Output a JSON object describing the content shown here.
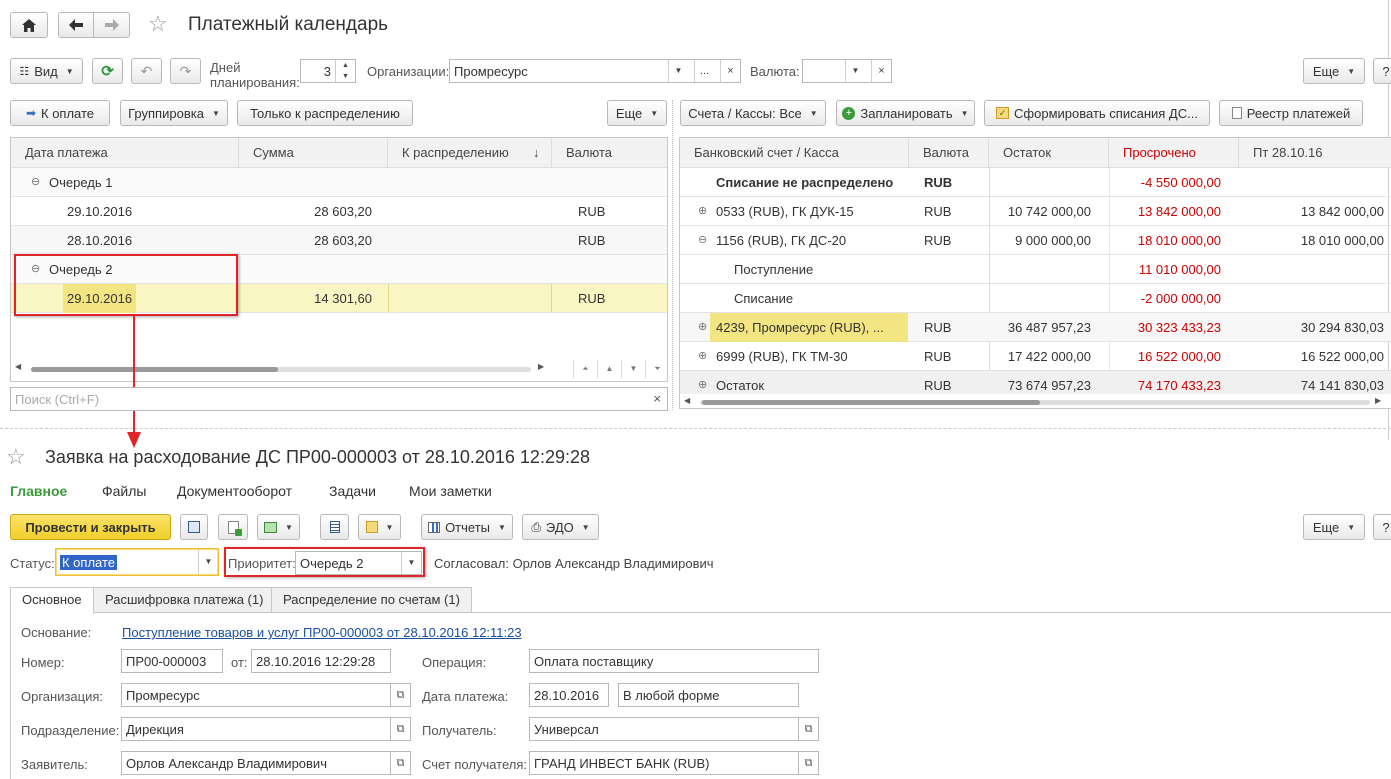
{
  "page": {
    "title": "Платежный календарь"
  },
  "toolbar1": {
    "view": "Вид",
    "days_label": "Дней планирования:",
    "days_value": "3",
    "org_label": "Организации:",
    "org_value": "Промресурс",
    "currency_label": "Валюта:",
    "currency_value": "",
    "more": "Еще",
    "help": "?"
  },
  "left_toolbar": {
    "to_pay": "К оплате",
    "grouping": "Группировка",
    "only_distr": "Только к распределению",
    "more": "Еще"
  },
  "left_table": {
    "columns": [
      "Дата платежа",
      "Сумма",
      "К распределению",
      "Валюта"
    ],
    "sort_glyph": "↓",
    "groups": [
      {
        "name": "Очередь 1",
        "rows": [
          {
            "date": "29.10.2016",
            "sum": "28 603,20",
            "distr": "",
            "cur": "RUB"
          },
          {
            "date": "28.10.2016",
            "sum": "28 603,20",
            "distr": "",
            "cur": "RUB"
          }
        ]
      },
      {
        "name": "Очередь 2",
        "rows": [
          {
            "date": "29.10.2016",
            "sum": "14 301,60",
            "distr": "",
            "cur": "RUB"
          }
        ]
      }
    ],
    "search_placeholder": "Поиск (Ctrl+F)"
  },
  "right_toolbar": {
    "accounts": "Счета / Кассы: Все",
    "plan": "Запланировать",
    "form_writeoff": "Сформировать списания ДС...",
    "registry": "Реестр платежей"
  },
  "right_table": {
    "columns": [
      "Банковский счет / Касса",
      "Валюта",
      "Остаток",
      "Просрочено",
      "Пт 28.10.16"
    ],
    "rows": [
      {
        "name": "Списание не распределено",
        "cur": "RUB",
        "bal": "",
        "over": "-4 550 000,00",
        "d1": "",
        "kind": "bold",
        "indent": 0,
        "expander": ""
      },
      {
        "name": "0533 (RUB), ГК ДУК-15",
        "cur": "RUB",
        "bal": "10 742 000,00",
        "over": "13 842 000,00",
        "d1": "13 842 000,00",
        "kind": "normal",
        "indent": 1,
        "expander": "⊕"
      },
      {
        "name": "1156 (RUB), ГК ДС-20",
        "cur": "RUB",
        "bal": "9 000 000,00",
        "over": "18 010 000,00",
        "d1": "18 010 000,00",
        "kind": "normal",
        "indent": 1,
        "expander": "⊖"
      },
      {
        "name": "Поступление",
        "cur": "",
        "bal": "",
        "over": "11 010 000,00",
        "d1": "",
        "kind": "normal",
        "indent": 2,
        "expander": ""
      },
      {
        "name": "Списание",
        "cur": "",
        "bal": "",
        "over": "-2 000 000,00",
        "d1": "",
        "kind": "normal",
        "indent": 2,
        "expander": ""
      },
      {
        "name": "4239, Промресурс (RUB), ...",
        "cur": "RUB",
        "bal": "36 487 957,23",
        "over": "30 323 433,23",
        "d1": "30 294 830,03",
        "kind": "selected",
        "indent": 1,
        "expander": "⊕"
      },
      {
        "name": "6999 (RUB), ГК ТМ-30",
        "cur": "RUB",
        "bal": "17 422 000,00",
        "over": "16 522 000,00",
        "d1": "16 522 000,00",
        "kind": "normal",
        "indent": 1,
        "expander": "⊕"
      },
      {
        "name": "Остаток",
        "cur": "RUB",
        "bal": "73 674 957,23",
        "over": "74 170 433,23",
        "d1": "74 141 830,03",
        "kind": "total",
        "indent": 1,
        "expander": "⊕"
      }
    ]
  },
  "doc": {
    "title": "Заявка на расходование ДС ПР00-000003 от 28.10.2016 12:29:28",
    "nav": [
      "Главное",
      "Файлы",
      "Документооборот",
      "Задачи",
      "Мои заметки"
    ],
    "post_close": "Провести и закрыть",
    "reports": "Отчеты",
    "edo": "ЭДО",
    "more": "Еще",
    "help": "?",
    "status_label": "Статус:",
    "status_value": "К оплате",
    "priority_label": "Приоритет:",
    "priority_value": "Очередь 2",
    "approved": "Согласовал: Орлов Александр Владимирович",
    "tabs": [
      "Основное",
      "Расшифровка платежа (1)",
      "Распределение по счетам (1)"
    ],
    "basis_label": "Основание:",
    "basis_link": "Поступление товаров и услуг ПР00-000003 от 28.10.2016 12:11:23",
    "number_label": "Номер:",
    "number_value": "ПР00-000003",
    "from_label": "от:",
    "from_value": "28.10.2016 12:29:28",
    "operation_label": "Операция:",
    "operation_value": "Оплата поставщику",
    "org_label": "Организация:",
    "org_value": "Промресурс",
    "paydate_label": "Дата платежа:",
    "paydate_value": "28.10.2016",
    "payform_value": "В любой форме",
    "dept_label": "Подразделение:",
    "dept_value": "Дирекция",
    "recipient_label": "Получатель:",
    "recipient_value": "Универсал",
    "applicant_label": "Заявитель:",
    "applicant_value": "Орлов Александр Владимирович",
    "account_label": "Счет получателя:",
    "account_value": "ГРАНД ИНВЕСТ БАНК (RUB)"
  },
  "colors": {
    "highlight_box": "#e0242a",
    "accent_green": "#3a9b3a",
    "link_blue": "#1a4fa0",
    "row_selected": "#faf6c4",
    "overdue_red": "#cc0000",
    "primary_btn": "#f4d83a"
  }
}
